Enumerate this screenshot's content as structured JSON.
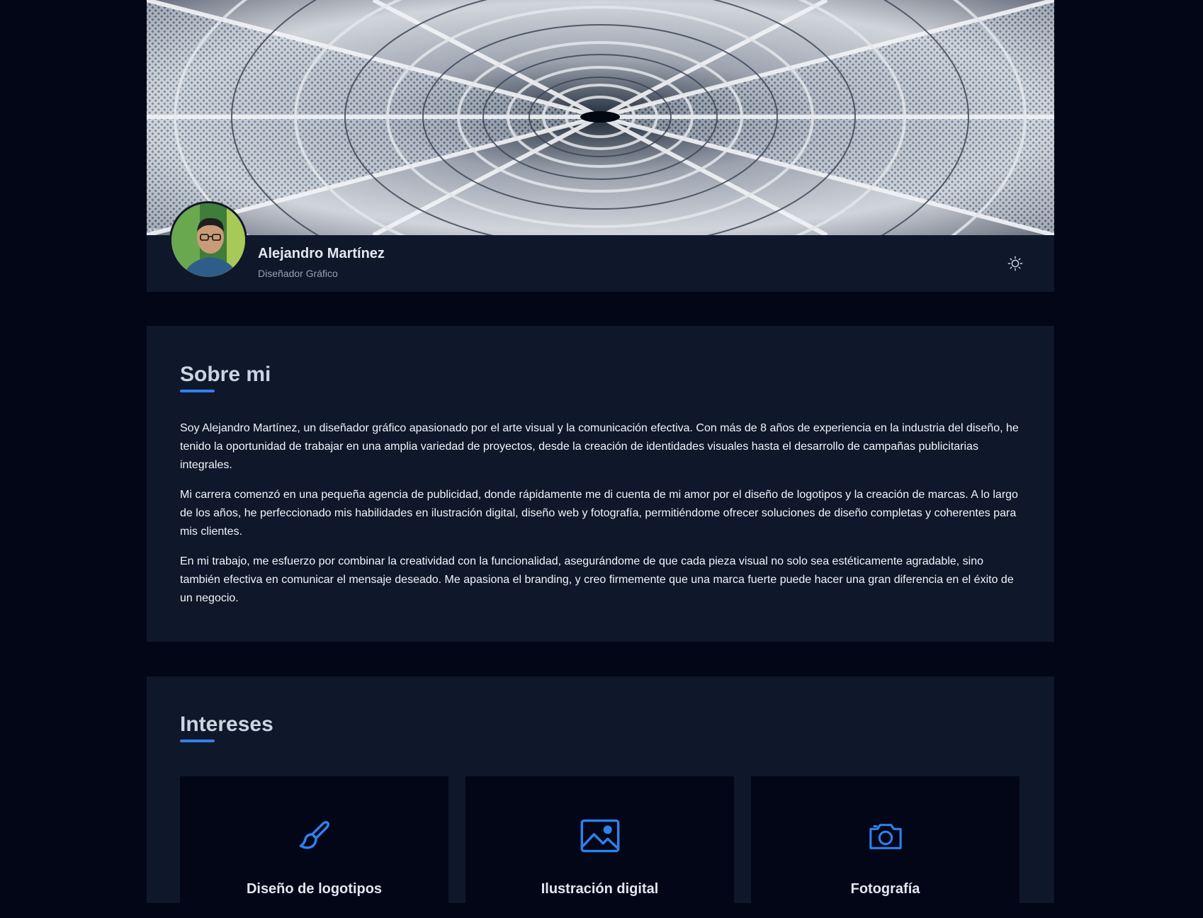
{
  "profile": {
    "name": "Alejandro Martínez",
    "role": "Diseñador Gráfico"
  },
  "colors": {
    "background": "#020617",
    "card": "#0f172a",
    "accent": "#2f80ed",
    "text": "#e2e8f0"
  },
  "header": {
    "cover_image": "steel-tunnel-architecture-photo",
    "theme_toggle_icon": "sun-icon"
  },
  "about": {
    "title": "Sobre mi",
    "paragraphs": [
      "Soy Alejandro Martínez, un diseñador gráfico apasionado por el arte visual y la comunicación efectiva. Con más de 8 años de experiencia en la industria del diseño, he tenido la oportunidad de trabajar en una amplia variedad de proyectos, desde la creación de identidades visuales hasta el desarrollo de campañas publicitarias integrales.",
      "Mi carrera comenzó en una pequeña agencia de publicidad, donde rápidamente me di cuenta de mi amor por el diseño de logotipos y la creación de marcas. A lo largo de los años, he perfeccionado mis habilidades en ilustración digital, diseño web y fotografía, permitiéndome ofrecer soluciones de diseño completas y coherentes para mis clientes.",
      "En mi trabajo, me esfuerzo por combinar la creatividad con la funcionalidad, asegurándome de que cada pieza visual no solo sea estéticamente agradable, sino también efectiva en comunicar el mensaje deseado. Me apasiona el branding, y creo firmemente que una marca fuerte puede hacer una gran diferencia en el éxito de un negocio."
    ]
  },
  "interests": {
    "title": "Intereses",
    "items": [
      {
        "label": "Diseño de logotipos",
        "icon": "paintbrush-icon"
      },
      {
        "label": "Ilustración digital",
        "icon": "image-icon"
      },
      {
        "label": "Fotografía",
        "icon": "camera-icon"
      }
    ]
  }
}
